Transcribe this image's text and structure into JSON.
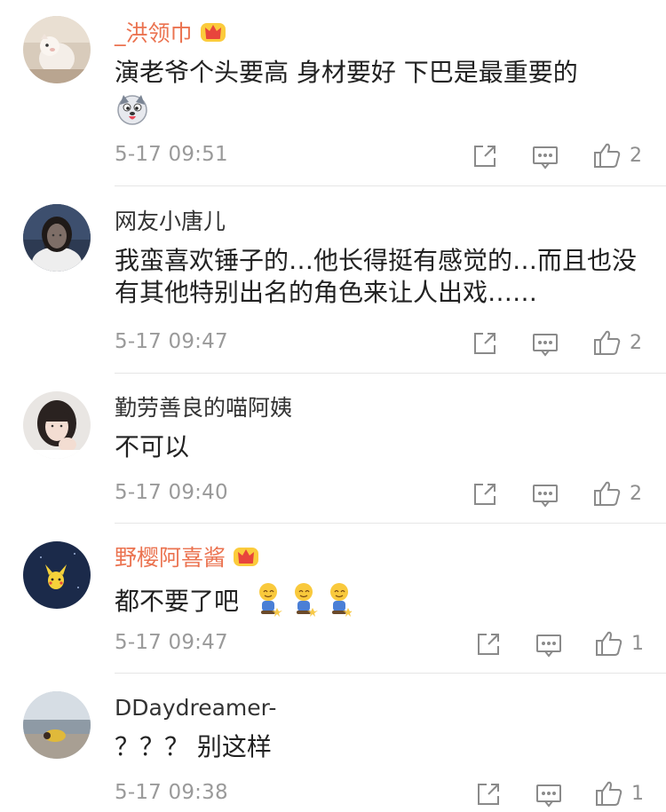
{
  "comments": [
    {
      "username": "_洪领巾",
      "vip": true,
      "text": "演老爷个头要高 身材要好 下巴是最重要的",
      "emoji": "dog-face-emoji",
      "time": "5-17 09:51",
      "likes": "2"
    },
    {
      "username": "网友小唐儿",
      "vip": false,
      "text": "我蛮喜欢锤子的…他长得挺有感觉的…而且也没有其他特别出名的角色来让人出戏……",
      "time": "5-17 09:47",
      "likes": "2"
    },
    {
      "username": "勤劳善良的喵阿姨",
      "vip": false,
      "text": "不可以",
      "time": "5-17 09:40",
      "likes": "2"
    },
    {
      "username": "野樱阿喜酱",
      "vip": true,
      "text": "都不要了吧",
      "emoji": "kneeling-smile-emoji",
      "time": "5-17 09:47",
      "likes": "1"
    },
    {
      "username": "DDaydreamer-",
      "vip": false,
      "text": "？？？ 别这样",
      "time": "5-17 09:38",
      "likes": "1"
    }
  ],
  "colors": {
    "vip_name": "#eb7350",
    "name": "#333333",
    "text": "#222222",
    "meta": "#9a9a9a",
    "icon": "#8a8a8a"
  },
  "icons": {
    "repost": "share-arrow-icon",
    "reply": "comment-icon",
    "like": "thumbs-up-icon",
    "badge": "crown-icon"
  }
}
